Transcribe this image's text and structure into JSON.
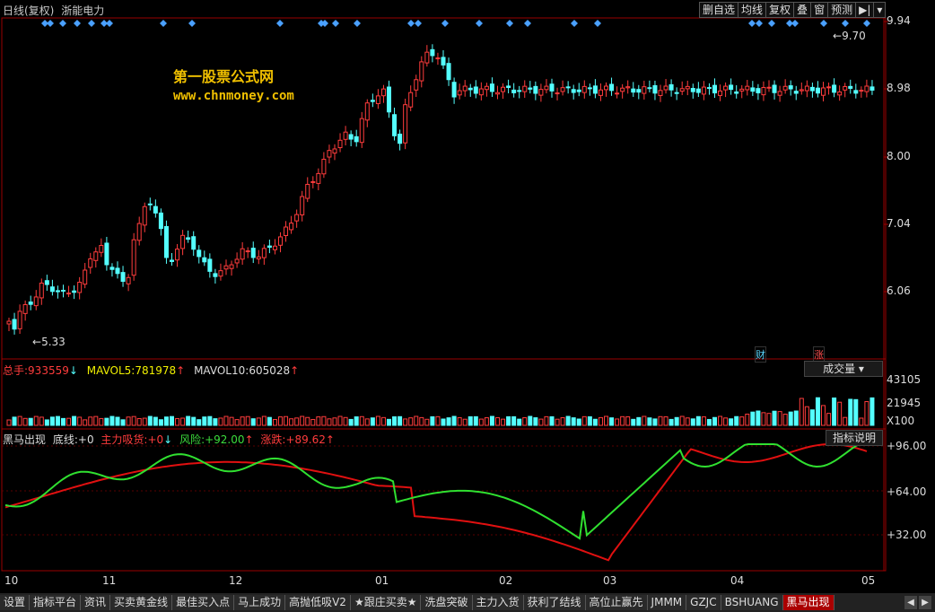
{
  "header": {
    "period": "日线(复权)",
    "stock_name": "浙能电力"
  },
  "toolbar": [
    "删自选",
    "均线",
    "复权",
    "叠",
    "窗",
    "预测"
  ],
  "watermark": {
    "line1": "第一股票公式网",
    "line2": "www.chnmoney.com"
  },
  "price_axis": [
    "9.94",
    "8.98",
    "8.00",
    "7.04",
    "6.06"
  ],
  "annotations": {
    "high": "9.70",
    "low": "5.33",
    "event1": "财",
    "event2": "涨"
  },
  "volume": {
    "label_total": "总手:",
    "total": "933559",
    "label_ma5": "MAVOL5:",
    "ma5": "781978",
    "label_ma10": "MAVOL10:",
    "ma10": "605028",
    "selector": "成交量",
    "axis": [
      "43105",
      "21945",
      "X100"
    ]
  },
  "indicator": {
    "name": "黑马出现",
    "base_label": "底线:",
    "base": "+0",
    "inflow_label": "主力吸货:",
    "inflow": "+0",
    "risk_label": "风险:",
    "risk": "+92.00",
    "rise_label": "涨跌:",
    "rise": "+89.62",
    "help_button": "指标说明",
    "axis": [
      "+96.00",
      "+64.00",
      "+32.00"
    ]
  },
  "x_axis": [
    "10",
    "11",
    "12",
    "01",
    "02",
    "03",
    "04",
    "05"
  ],
  "bottom_tabs": [
    "设置",
    "指标平台",
    "资讯",
    "买卖黄金线",
    "最佳买入点",
    "马上成功",
    "高抛低吸V2",
    "★跟庄买卖★",
    "洗盘突破",
    "主力入货",
    "获利了结线",
    "高位止赢先",
    "JMMM",
    "GZJC",
    "BSHUANG",
    "黑马出现"
  ],
  "colors": {
    "up": "#ff3c3c",
    "down": "#54ffff",
    "green": "#3cdc3c",
    "red": "#dc0000"
  }
}
